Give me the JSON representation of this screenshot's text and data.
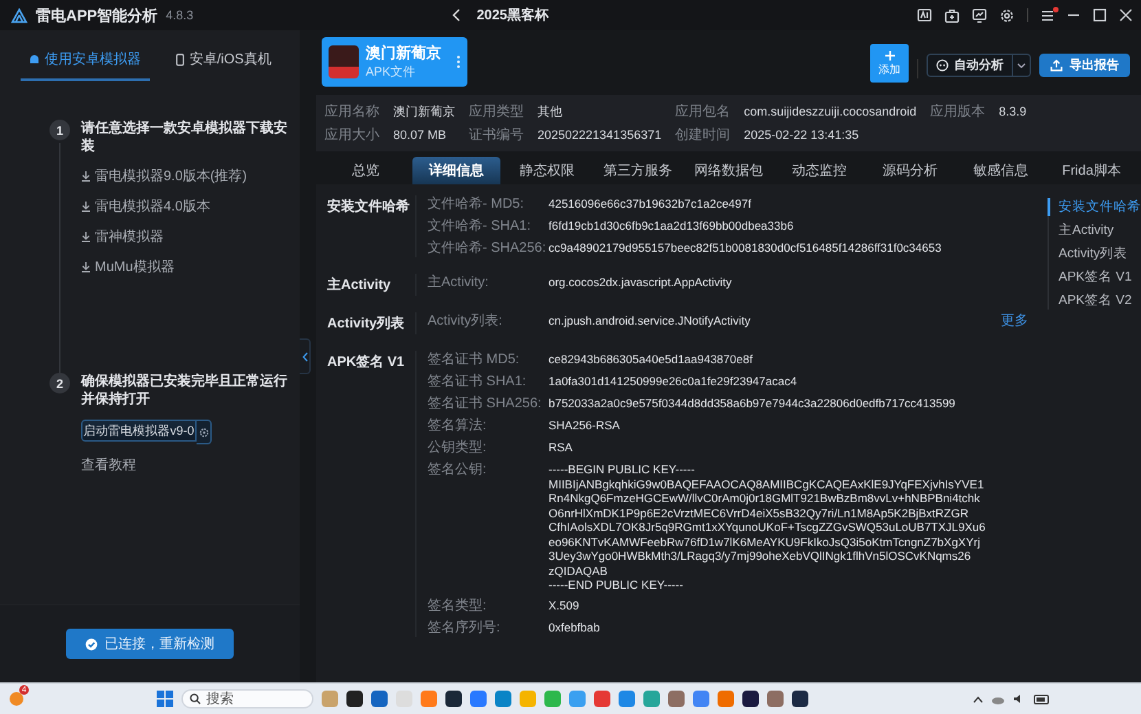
{
  "window": {
    "title": "雷电APP智能分析",
    "version": "4.8.3",
    "project": "2025黑客杯",
    "menu_notification": true
  },
  "sidebar": {
    "modes": [
      {
        "label": "使用安卓模拟器",
        "selected": true
      },
      {
        "label": "安卓/iOS真机",
        "selected": false
      }
    ],
    "steps": [
      {
        "number": "1",
        "text": "请任意选择一款安卓模拟器下载安装",
        "links": [
          "雷电模拟器9.0版本(推荐)",
          "雷电模拟器4.0版本",
          "雷神模拟器",
          "MuMu模拟器"
        ]
      },
      {
        "number": "2",
        "text": "确保模拟器已安装完毕且正常运行并保持打开",
        "launch_button": "启动雷电模拟器v9-0",
        "tutorial_link": "查看教程"
      }
    ],
    "status_button": "已连接，重新检测"
  },
  "toolbar": {
    "add_button": "添加",
    "analyze_button": "自动分析",
    "export_button": "导出报告"
  },
  "app": {
    "name": "澳门新葡京",
    "file_type": "APK文件",
    "info": [
      {
        "label": "应用名称",
        "value": "澳门新葡京"
      },
      {
        "label": "应用类型",
        "value": "其他"
      },
      {
        "label": "应用包名",
        "value": "com.suijideszzuiji.cocosandroid"
      },
      {
        "label": "应用版本",
        "value": "8.3.9"
      },
      {
        "label": "应用大小",
        "value": "80.07 MB"
      },
      {
        "label": "证书编号",
        "value": "202502221341356371"
      },
      {
        "label": "创建时间",
        "value": "2025-02-22 13:41:35"
      }
    ]
  },
  "tabs": [
    {
      "label": "总览",
      "selected": false
    },
    {
      "label": "详细信息",
      "selected": true
    },
    {
      "label": "静态权限",
      "selected": false
    },
    {
      "label": "第三方服务",
      "selected": false
    },
    {
      "label": "网络数据包",
      "selected": false
    },
    {
      "label": "动态监控",
      "selected": false
    },
    {
      "label": "源码分析",
      "selected": false
    },
    {
      "label": "敏感信息",
      "selected": false
    },
    {
      "label": "Frida脚本",
      "selected": false
    }
  ],
  "sections": [
    {
      "title": "安装文件哈希",
      "fields": [
        {
          "label": "文件哈希- MD5:",
          "value": "42516096e66c37b19632b7c1a2ce497f"
        },
        {
          "label": "文件哈希- SHA1:",
          "value": "f6fd19cb1d30c6fb9c1aa2d13f69bb00dbea33b6"
        },
        {
          "label": "文件哈希- SHA256:",
          "value": "cc9a48902179d955157beec82f51b0081830d0cf516485f14286ff31f0c34653"
        }
      ]
    },
    {
      "title": "主Activity",
      "fields": [
        {
          "label": "主Activity:",
          "value": "org.cocos2dx.javascript.AppActivity"
        }
      ]
    },
    {
      "title": "Activity列表",
      "fields": [
        {
          "label": "Activity列表:",
          "value": "cn.jpush.android.service.JNotifyActivity"
        }
      ],
      "more_link": "更多"
    },
    {
      "title": "APK签名 V1",
      "fields": [
        {
          "label": "签名证书 MD5:",
          "value": "ce82943b686305a40e5d1aa943870e8f"
        },
        {
          "label": "签名证书 SHA1:",
          "value": "1a0fa301d141250999e26c0a1fe29f23947acac4"
        },
        {
          "label": "签名证书 SHA256:",
          "value": "b752033a2a0c9e575f0344d8dd358a6b97e7944c3a22806d0edfb717cc413599"
        },
        {
          "label": "签名算法:",
          "value": "SHA256-RSA"
        },
        {
          "label": "公钥类型:",
          "value": "RSA"
        },
        {
          "label": "签名公钥:",
          "value": "-----BEGIN PUBLIC KEY-----\nMIIBIjANBgkqhkiG9w0BAQEFAAOCAQ8AMIIBCgKCAQEAxKlE9JYqFEXjvhIsYVE1\nRn4NkgQ6FmzeHGCEwW/llvC0rAm0j0r18GMlT921BwBzBm8vvLv+hNBPBni4tchk\nO6nrHlXmDK1P9p6E2cVrztMEC6VrrD4eiX5sB32Qy7ri/Ln1M8Ap5K2BjBxtRZGR\nCfhIAolsXDL7OK8Jr5q9RGmt1xXYqunoUKoF+TscgZZGvSWQ53uLoUB7TXJL9Xu6\neo96KNTvKAMWFeebRw76fD1w7lK6MeAYKU9FkIkoJsQ3i5oKtmTcngnZ7bXgXYrj\n3Uey3wYgo0HWBkMth3/LRagq3/y7mj99oheXebVQlINgk1flhVn5lOSCvKNqms26\nzQIDAQAB\n-----END PUBLIC KEY-----"
        },
        {
          "label": "签名类型:",
          "value": "X.509"
        },
        {
          "label": "签名序列号:",
          "value": "0xfebfbab"
        }
      ]
    }
  ],
  "section_nav": [
    {
      "label": "安装文件哈希",
      "selected": true
    },
    {
      "label": "主Activity",
      "selected": false
    },
    {
      "label": "Activity列表",
      "selected": false
    },
    {
      "label": "APK签名 V1",
      "selected": false
    },
    {
      "label": "APK签名 V2",
      "selected": false
    }
  ],
  "taskbar": {
    "badge": "4",
    "search_placeholder": "搜索"
  }
}
